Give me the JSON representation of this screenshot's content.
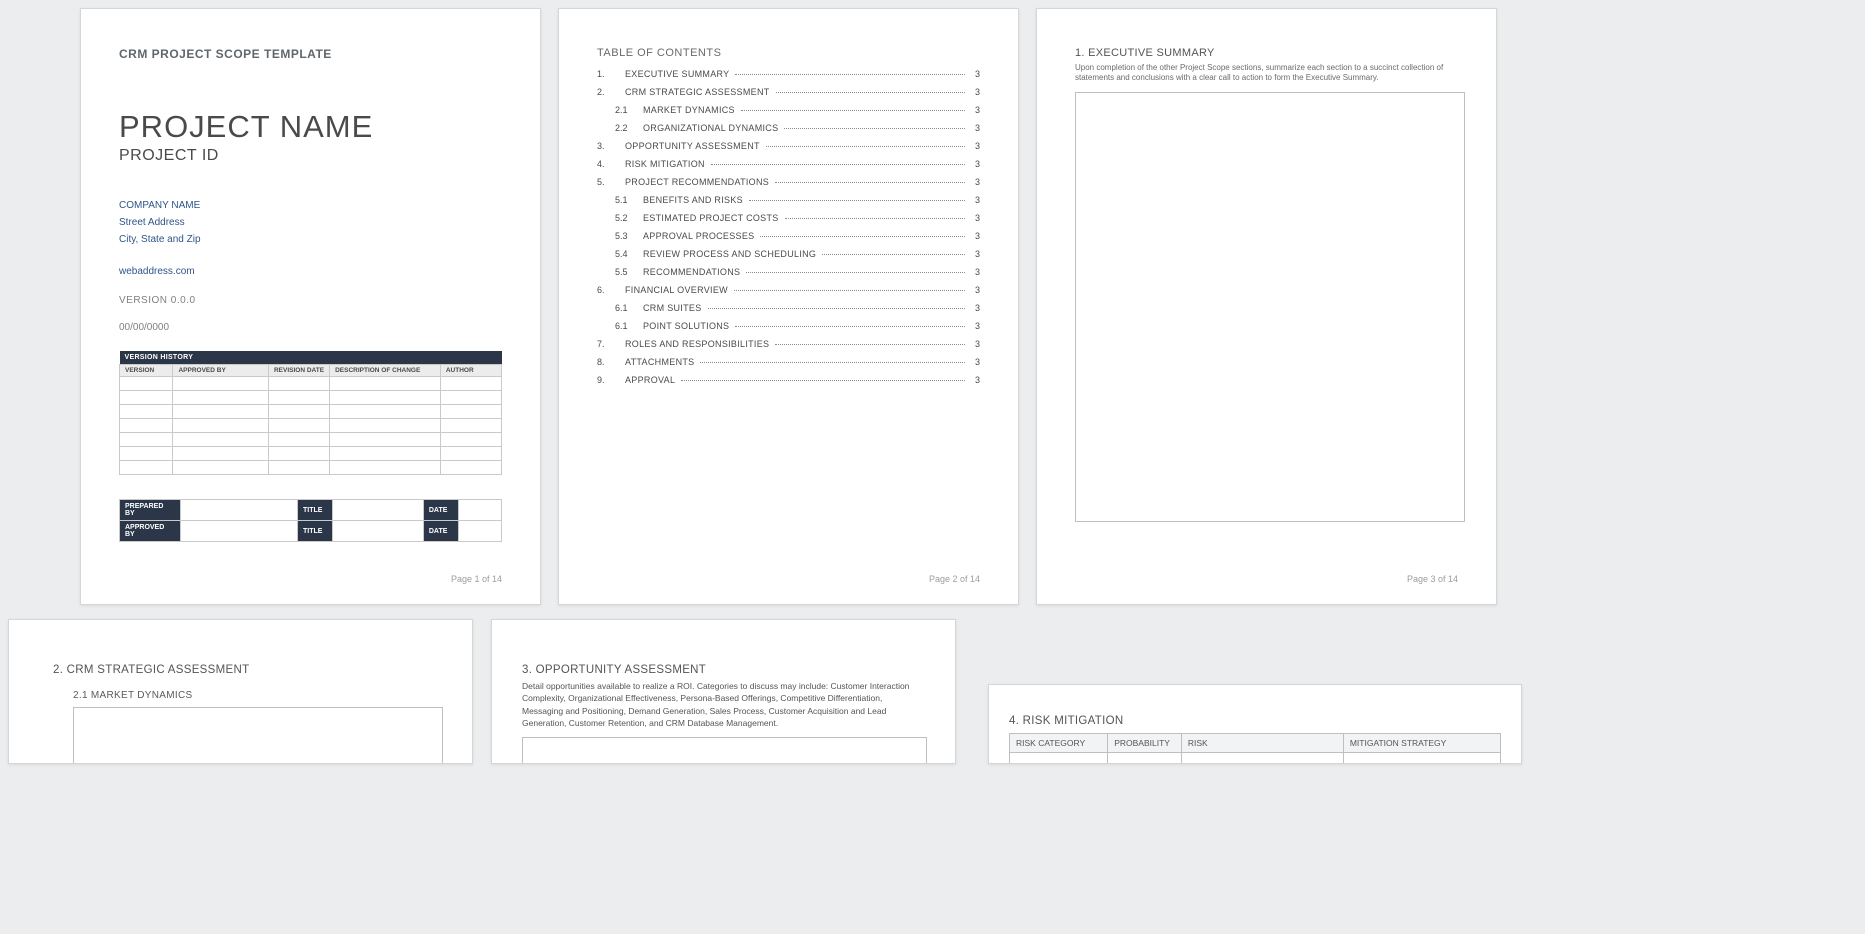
{
  "page1": {
    "doc_title": "CRM PROJECT SCOPE TEMPLATE",
    "project_name": "PROJECT NAME",
    "project_id": "PROJECT ID",
    "company_name": "COMPANY NAME",
    "street": "Street Address",
    "city": "City, State and Zip",
    "web": "webaddress.com",
    "version": "VERSION 0.0.0",
    "date": "00/00/0000",
    "vh_head": "VERSION HISTORY",
    "vh_cols": [
      "VERSION",
      "APPROVED BY",
      "REVISION DATE",
      "DESCRIPTION OF CHANGE",
      "AUTHOR"
    ],
    "sig": {
      "prepared": "PREPARED BY",
      "approved": "APPROVED BY",
      "title": "TITLE",
      "date": "DATE"
    },
    "page_num": "Page 1 of 14"
  },
  "page2": {
    "title": "TABLE OF CONTENTS",
    "items": [
      {
        "n": "1.",
        "t": "EXECUTIVE SUMMARY",
        "p": "3",
        "sub": false
      },
      {
        "n": "2.",
        "t": "CRM STRATEGIC ASSESSMENT",
        "p": "3",
        "sub": false
      },
      {
        "n": "2.1",
        "t": "MARKET DYNAMICS",
        "p": "3",
        "sub": true
      },
      {
        "n": "2.2",
        "t": "ORGANIZATIONAL DYNAMICS",
        "p": "3",
        "sub": true
      },
      {
        "n": "3.",
        "t": "OPPORTUNITY ASSESSMENT",
        "p": "3",
        "sub": false
      },
      {
        "n": "4.",
        "t": "RISK MITIGATION",
        "p": "3",
        "sub": false
      },
      {
        "n": "5.",
        "t": "PROJECT RECOMMENDATIONS",
        "p": "3",
        "sub": false
      },
      {
        "n": "5.1",
        "t": "BENEFITS AND RISKS",
        "p": "3",
        "sub": true
      },
      {
        "n": "5.2",
        "t": "ESTIMATED PROJECT COSTS",
        "p": "3",
        "sub": true
      },
      {
        "n": "5.3",
        "t": "APPROVAL PROCESSES",
        "p": "3",
        "sub": true
      },
      {
        "n": "5.4",
        "t": "REVIEW PROCESS AND SCHEDULING",
        "p": "3",
        "sub": true
      },
      {
        "n": "5.5",
        "t": "RECOMMENDATIONS",
        "p": "3",
        "sub": true
      },
      {
        "n": "6.",
        "t": "FINANCIAL OVERVIEW",
        "p": "3",
        "sub": false
      },
      {
        "n": "6.1",
        "t": "CRM SUITES",
        "p": "3",
        "sub": true
      },
      {
        "n": "6.1",
        "t": "POINT SOLUTIONS",
        "p": "3",
        "sub": true
      },
      {
        "n": "7.",
        "t": "ROLES AND RESPONSIBILITIES",
        "p": "3",
        "sub": false
      },
      {
        "n": "8.",
        "t": "ATTACHMENTS",
        "p": "3",
        "sub": false
      },
      {
        "n": "9.",
        "t": "APPROVAL",
        "p": "3",
        "sub": false
      }
    ],
    "page_num": "Page 2 of 14"
  },
  "page3": {
    "heading": "1.  EXECUTIVE SUMMARY",
    "desc": "Upon completion of the other Project Scope sections, summarize each section to a succinct collection of statements and conclusions with a clear call to action to form the Executive Summary.",
    "page_num": "Page 3 of 14"
  },
  "page4": {
    "heading": "2.  CRM STRATEGIC ASSESSMENT",
    "sub": "2.1      MARKET DYNAMICS"
  },
  "page5": {
    "heading": "3.  OPPORTUNITY ASSESSMENT",
    "desc": "Detail opportunities available to realize a ROI.  Categories to discuss may include: Customer Interaction Complexity, Organizational Effectiveness, Persona-Based Offerings, Competitive Differentiation, Messaging and Positioning, Demand Generation, Sales Process, Customer Acquisition and Lead Generation, Customer Retention, and CRM Database Management."
  },
  "page6": {
    "heading": "4.  RISK MITIGATION",
    "cols": [
      "RISK CATEGORY",
      "PROBABILITY",
      "RISK",
      "MITIGATION STRATEGY"
    ]
  }
}
